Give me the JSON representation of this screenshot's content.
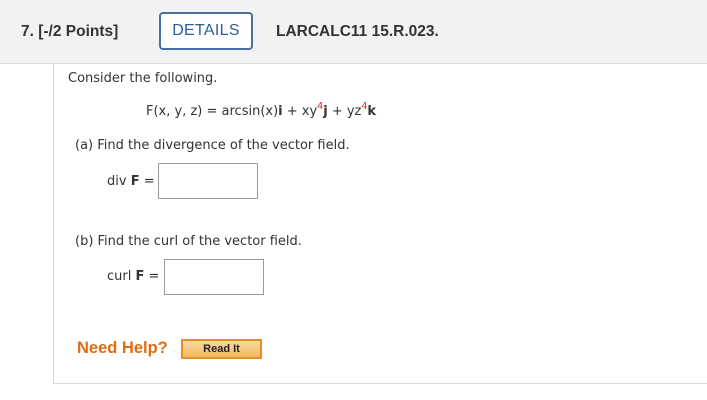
{
  "question": {
    "number_points": "7.  [-/2 Points]",
    "details_label": "DETAILS",
    "problem_id": "LARCALC11 15.R.023."
  },
  "prompt": "Consider the following.",
  "formula": {
    "lhs": "F(x, y, z) = arcsin(x)",
    "i": "i",
    "plus1": " + xy",
    "exp1": "4",
    "j": "j",
    "plus2": " + yz",
    "exp2": "4",
    "k": "k"
  },
  "part_a": {
    "label": "(a)   Find the divergence of the vector field.",
    "answer_label_prefix": "div ",
    "answer_label_bold": "F",
    "answer_label_suffix": " =",
    "answer_value": ""
  },
  "part_b": {
    "label": "(b)   Find the curl of the vector field.",
    "answer_label_prefix": "curl ",
    "answer_label_bold": "F",
    "answer_label_suffix": " =",
    "answer_value": ""
  },
  "help": {
    "need_help": "Need Help?",
    "read_it": "Read It"
  },
  "colors": {
    "accent_blue": "#2f5c96",
    "exponent_red": "#d62b2b",
    "help_orange": "#e06d10"
  }
}
